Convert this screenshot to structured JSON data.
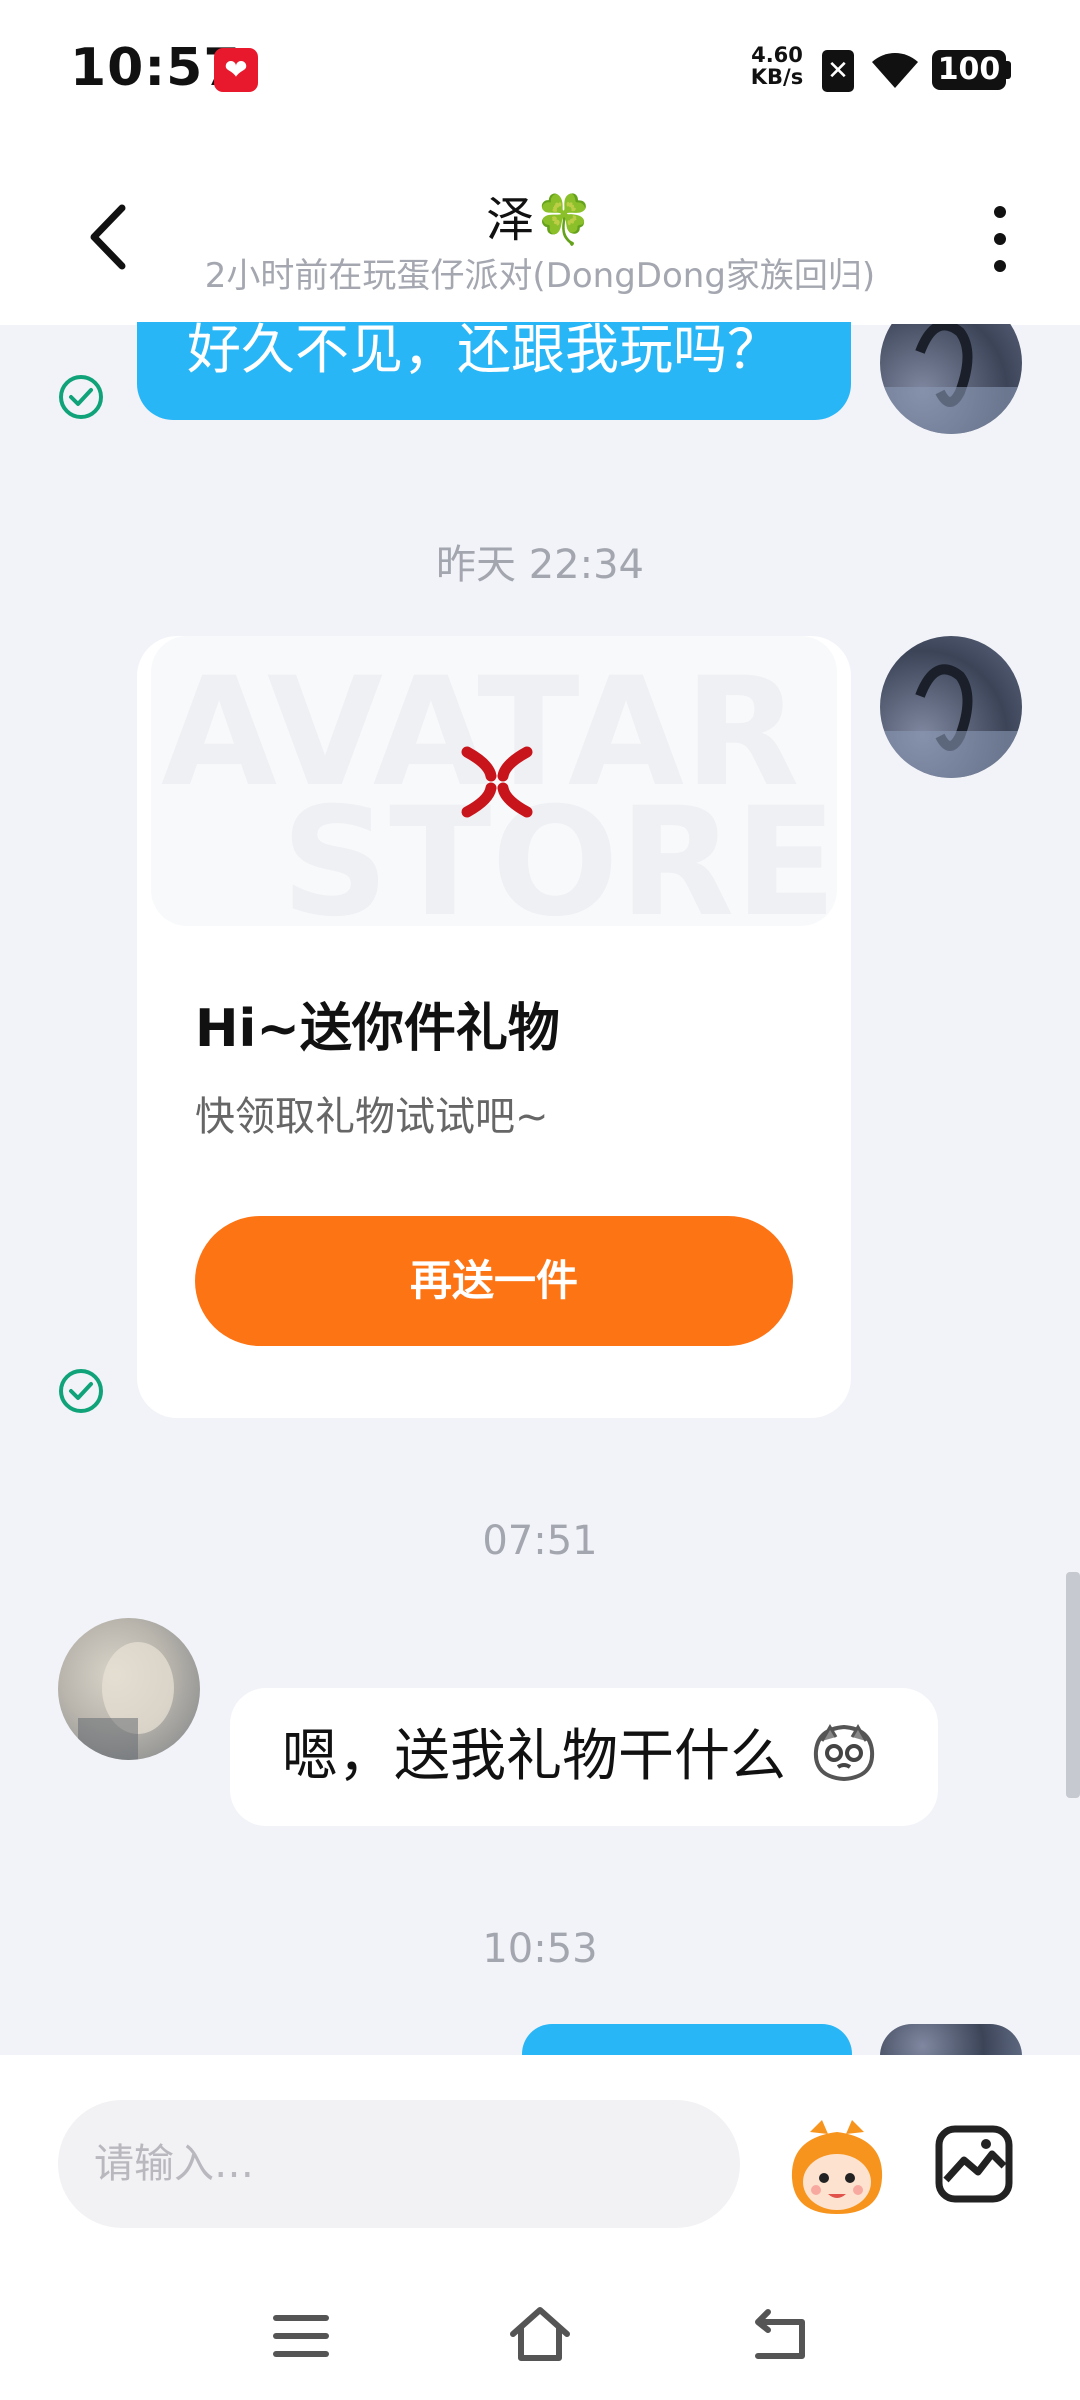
{
  "status_bar": {
    "time": "10:57",
    "net_speed_value": "4.60",
    "net_speed_unit": "KB/s",
    "sim_label": "✕",
    "battery": "100"
  },
  "header": {
    "title": "泽🍀",
    "subtitle": "2小时前在玩蛋仔派对(DongDong家族回归)"
  },
  "messages": {
    "msg1_text": "好久不见，还跟我玩吗？",
    "ts1": "昨天 22:34",
    "gift_card": {
      "watermark_line1": "AVATAR",
      "watermark_line2": "STORE",
      "title": "Hi~送你件礼物",
      "description": "快领取礼物试试吧~",
      "button_label": "再送一件"
    },
    "ts2": "07:51",
    "peer_text": "嗯，送我礼物干什么",
    "ts3": "10:53"
  },
  "input": {
    "placeholder": "请输入…"
  },
  "colors": {
    "self_bubble": "#29b6f6",
    "gift_button": "#fd7414",
    "read_check": "#10a37a",
    "background": "#f2f3f8"
  }
}
